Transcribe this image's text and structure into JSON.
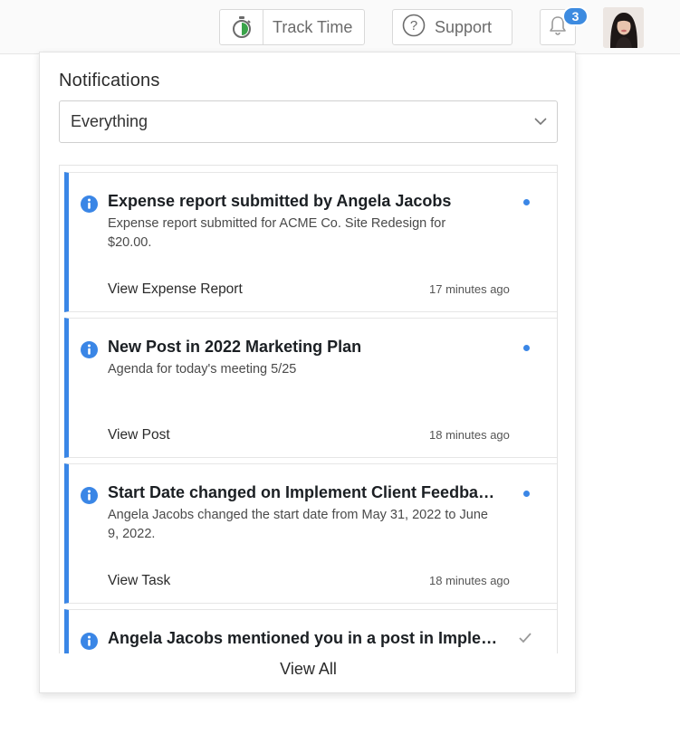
{
  "topbar": {
    "track_time_label": "Track Time",
    "support_label": "Support",
    "notification_count": "3"
  },
  "panel": {
    "title": "Notifications",
    "filter_value": "Everything",
    "view_all_label": "View All"
  },
  "notifications": [
    {
      "title": "Expense report submitted by Angela Jacobs",
      "body": "Expense report submitted for ACME Co. Site Redesign for $20.00.",
      "link": "View Expense Report",
      "time": "17 minutes ago",
      "status": "unread"
    },
    {
      "title": "New Post in 2022 Marketing Plan",
      "body": "Agenda for today's meeting 5/25",
      "link": "View Post",
      "time": "18 minutes ago",
      "status": "unread"
    },
    {
      "title": "Start Date changed on Implement Client Feedbac...",
      "body": "Angela Jacobs changed the start date from May 31, 2022 to June 9, 2022.",
      "link": "View Task",
      "time": "18 minutes ago",
      "status": "unread"
    },
    {
      "title": "Angela Jacobs mentioned you in a post in Implem...",
      "body": "",
      "link": "",
      "time": "",
      "status": "read"
    }
  ],
  "colors": {
    "accent": "#3a86e6",
    "badge": "#3d8be0"
  }
}
